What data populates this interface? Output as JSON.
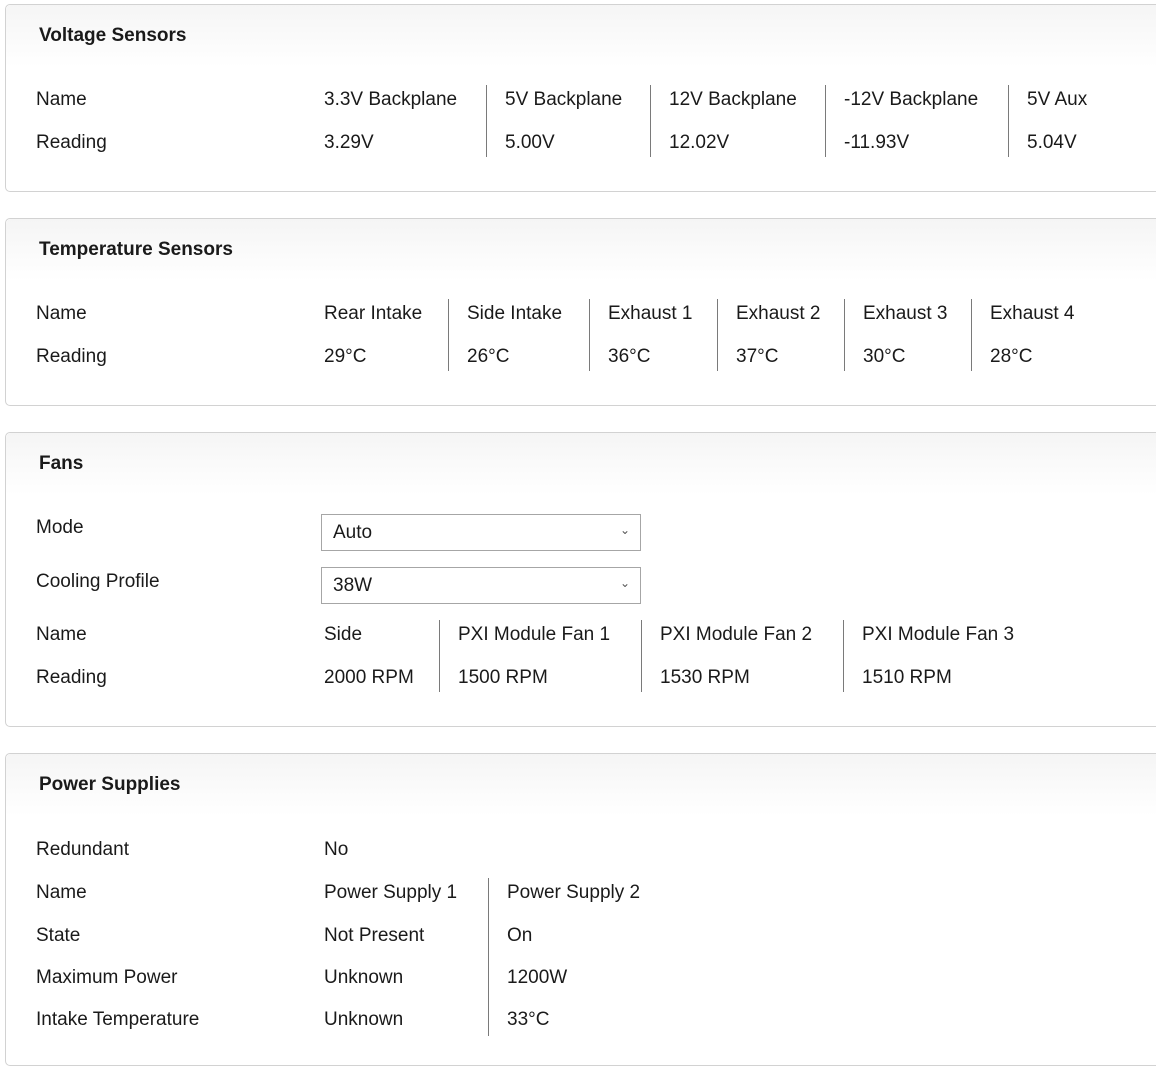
{
  "voltage": {
    "title": "Voltage Sensors",
    "name_label": "Name",
    "reading_label": "Reading",
    "columns": [
      {
        "name": "3.3V Backplane",
        "reading": "3.29V"
      },
      {
        "name": "5V Backplane",
        "reading": "5.00V"
      },
      {
        "name": "12V Backplane",
        "reading": "12.02V"
      },
      {
        "name": "-12V Backplane",
        "reading": "-11.93V"
      },
      {
        "name": "5V Aux",
        "reading": "5.04V"
      }
    ]
  },
  "temperature": {
    "title": "Temperature Sensors",
    "name_label": "Name",
    "reading_label": "Reading",
    "columns": [
      {
        "name": "Rear Intake",
        "reading": "29°C"
      },
      {
        "name": "Side Intake",
        "reading": "26°C"
      },
      {
        "name": "Exhaust 1",
        "reading": "36°C"
      },
      {
        "name": "Exhaust 2",
        "reading": "37°C"
      },
      {
        "name": "Exhaust 3",
        "reading": "30°C"
      },
      {
        "name": "Exhaust 4",
        "reading": "28°C"
      }
    ]
  },
  "fans": {
    "title": "Fans",
    "mode_label": "Mode",
    "mode_value": "Auto",
    "profile_label": "Cooling Profile",
    "profile_value": "38W",
    "name_label": "Name",
    "reading_label": "Reading",
    "columns": [
      {
        "name": "Side",
        "reading": "2000 RPM"
      },
      {
        "name": "PXI Module Fan 1",
        "reading": "1500 RPM"
      },
      {
        "name": "PXI Module Fan 2",
        "reading": "1530 RPM"
      },
      {
        "name": "PXI Module Fan 3",
        "reading": "1510 RPM"
      }
    ]
  },
  "power": {
    "title": "Power Supplies",
    "redundant_label": "Redundant",
    "redundant_value": "No",
    "name_label": "Name",
    "state_label": "State",
    "max_power_label": "Maximum Power",
    "intake_label": "Intake Temperature",
    "supplies": [
      {
        "name": "Power Supply 1",
        "state": "Not Present",
        "max_power": "Unknown",
        "intake": "Unknown"
      },
      {
        "name": "Power Supply 2",
        "state": "On",
        "max_power": "1200W",
        "intake": "33°C"
      }
    ]
  }
}
